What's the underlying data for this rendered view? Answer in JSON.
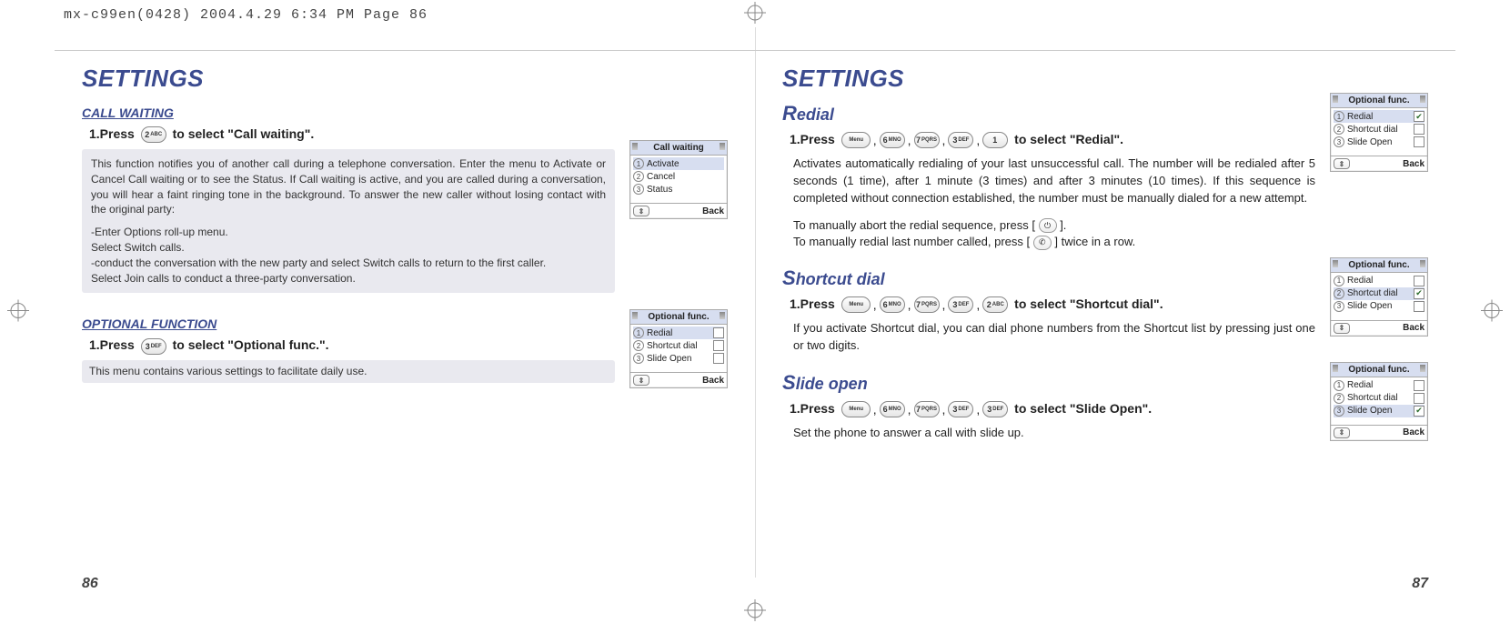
{
  "print_header": "mx-c99en(0428)  2004.4.29  6:34 PM  Page 86",
  "left": {
    "title": "SETTINGS",
    "page_num": "86",
    "call_waiting": {
      "heading": "CALL WAITING",
      "step_prefix": "1.Press",
      "key": {
        "top": "2",
        "bottom": "ABC"
      },
      "step_suffix": "to select \"Call waiting\".",
      "info": "This function notifies you of another call during a telephone conversation. Enter the menu to Activate or Cancel Call waiting or to see the Status. If Call waiting is active, and you are called during a conversation, you will hear a faint ringing tone in the background. To answer the new caller without losing contact with the original party:",
      "bullets": [
        "-Enter Options roll-up menu.",
        "Select Switch calls.",
        " -conduct the conversation with the new party and select Switch calls to return to the first caller.",
        "Select Join calls to conduct a three-party conversation."
      ],
      "phone": {
        "title": "Call waiting",
        "rows": [
          {
            "n": "1",
            "label": "Activate",
            "selected": true
          },
          {
            "n": "2",
            "label": "Cancel"
          },
          {
            "n": "3",
            "label": "Status"
          }
        ],
        "back": "Back"
      }
    },
    "optional": {
      "heading": "OPTIONAL FUNCTION",
      "step_prefix": "1.Press",
      "key": {
        "top": "3",
        "bottom": "DEF"
      },
      "step_suffix": "to select \"Optional func.\".",
      "info": "This menu contains various settings to facilitate daily use.",
      "phone": {
        "title": "Optional func.",
        "rows": [
          {
            "n": "1",
            "label": "Redial",
            "selected": true,
            "check": false
          },
          {
            "n": "2",
            "label": "Shortcut dial",
            "check": false
          },
          {
            "n": "3",
            "label": "Slide Open",
            "check": false
          }
        ],
        "back": "Back"
      }
    }
  },
  "right": {
    "title": "SETTINGS",
    "page_num": "87",
    "redial": {
      "heading": "Redial",
      "step_prefix": "1.Press",
      "keys": [
        {
          "top": "",
          "bottom": "Menu",
          "menu": true
        },
        {
          "top": "6",
          "bottom": "MNO"
        },
        {
          "top": "7",
          "bottom": "PQRS"
        },
        {
          "top": "3",
          "bottom": "DEF"
        },
        {
          "top": "1",
          "bottom": ""
        }
      ],
      "step_suffix": "to select \"Redial\".",
      "para": "Activates automatically redialing of your last unsuccessful call. The number will be redialed after 5 seconds (1 time), after 1 minute (3 times) and after 3 minutes (10 times). If this sequence is completed without connection established, the number must be manually dialed for a new attempt.",
      "note1_pre": "To manually abort the redial sequence, press [",
      "note1_post": "].",
      "note2_pre": "To manually redial last number called, press [",
      "note2_post": "] twice in a row.",
      "phone": {
        "title": "Optional func.",
        "rows": [
          {
            "n": "1",
            "label": "Redial",
            "selected": true,
            "check": true
          },
          {
            "n": "2",
            "label": "Shortcut dial",
            "check": false
          },
          {
            "n": "3",
            "label": "Slide Open",
            "check": false
          }
        ],
        "back": "Back"
      }
    },
    "shortcut": {
      "heading": "Shortcut dial",
      "step_prefix": "1.Press",
      "keys": [
        {
          "top": "",
          "bottom": "Menu",
          "menu": true
        },
        {
          "top": "6",
          "bottom": "MNO"
        },
        {
          "top": "7",
          "bottom": "PQRS"
        },
        {
          "top": "3",
          "bottom": "DEF"
        },
        {
          "top": "2",
          "bottom": "ABC"
        }
      ],
      "step_suffix": "to select \"Shortcut dial\".",
      "para": "If you activate Shortcut dial, you can dial phone numbers from the Shortcut list by pressing just one or two digits.",
      "phone": {
        "title": "Optional func.",
        "rows": [
          {
            "n": "1",
            "label": "Redial",
            "check": false
          },
          {
            "n": "2",
            "label": "Shortcut dial",
            "selected": true,
            "check": true
          },
          {
            "n": "3",
            "label": "Slide Open",
            "check": false
          }
        ],
        "back": "Back"
      }
    },
    "slide": {
      "heading": "Slide open",
      "step_prefix": "1.Press",
      "keys": [
        {
          "top": "",
          "bottom": "Menu",
          "menu": true
        },
        {
          "top": "6",
          "bottom": "MNO"
        },
        {
          "top": "7",
          "bottom": "PQRS"
        },
        {
          "top": "3",
          "bottom": "DEF"
        },
        {
          "top": "3",
          "bottom": "DEF"
        }
      ],
      "step_suffix": "to select \"Slide Open\".",
      "para": "Set the phone to answer a call with slide up.",
      "phone": {
        "title": "Optional func.",
        "rows": [
          {
            "n": "1",
            "label": "Redial",
            "check": false
          },
          {
            "n": "2",
            "label": "Shortcut dial",
            "check": false
          },
          {
            "n": "3",
            "label": "Slide Open",
            "selected": true,
            "check": true
          }
        ],
        "back": "Back"
      }
    }
  },
  "icons": {
    "hangup": "⌐",
    "call": "●",
    "nav": "⇕"
  }
}
